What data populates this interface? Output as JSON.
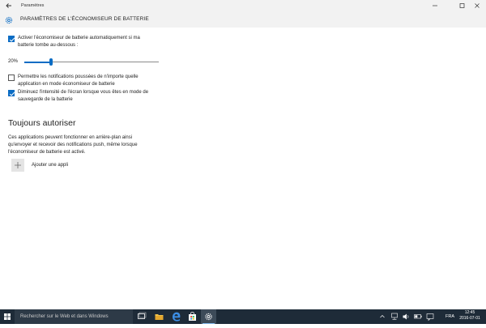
{
  "window": {
    "title": "Paramètres",
    "back_icon": "back-arrow-icon",
    "controls": [
      "minimize",
      "maximize",
      "close"
    ]
  },
  "header": {
    "icon": "gear-icon",
    "title": "PARAMÈTRES DE L'ÉCONOMISEUR DE BATTERIE"
  },
  "settings": {
    "auto_enable": {
      "checked": true,
      "line1": "Activer l'économiseur de batterie automatiquement si ma",
      "line2": "batterie tombe au-dessous :"
    },
    "threshold": {
      "label": "20%",
      "value_fraction": 0.2
    },
    "push_notifications": {
      "checked": false,
      "line1": "Permettre les notifications poussées de n'importe quelle",
      "line2": "application en mode économiseur de batterie"
    },
    "dim_screen": {
      "checked": true,
      "line1": "Diminuez l'intensité de l'écran lorsque vous êtes en mode de",
      "line2": "sauvegarde de la batterie"
    }
  },
  "always_allow": {
    "title": "Toujours autoriser",
    "desc_line1": "Ces applications peuvent fonctionner en arrière-plan ainsi",
    "desc_line2": "qu'envoyer et recevoir des notifications push, même lorsque",
    "desc_line3": "l'économiseur de batterie est activé.",
    "add_label": "Ajouter une appli",
    "add_icon": "plus-icon"
  },
  "taskbar": {
    "search_placeholder": "Rechercher sur le Web et dans Windows",
    "pinned": [
      "task-view-icon",
      "file-explorer-icon",
      "edge-icon",
      "store-icon",
      "settings-icon"
    ],
    "active_app": "settings-icon",
    "language": "FRA",
    "time": "12:45",
    "date": "2016-07-01",
    "accent_color": "#0a6cc4"
  }
}
